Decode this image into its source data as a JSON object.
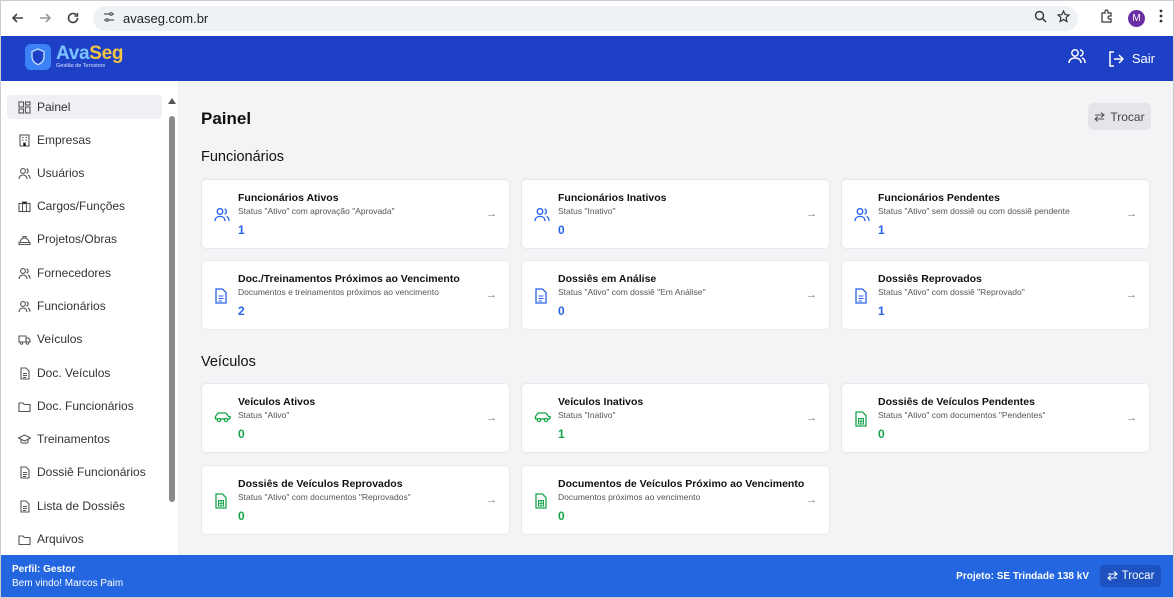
{
  "browser": {
    "url": "avaseg.com.br",
    "profile_initial": "M"
  },
  "app": {
    "brand_part1": "Ava",
    "brand_part2": "Seg",
    "brand_sub": "Gestão de Terceiros",
    "logout_label": "Sair"
  },
  "sidebar": {
    "items": [
      {
        "label": "Painel",
        "icon": "dashboard-icon",
        "active": true
      },
      {
        "label": "Empresas",
        "icon": "building-icon"
      },
      {
        "label": "Usuários",
        "icon": "users-icon"
      },
      {
        "label": "Cargos/Funções",
        "icon": "briefcase-icon"
      },
      {
        "label": "Projetos/Obras",
        "icon": "hard-hat-icon"
      },
      {
        "label": "Fornecedores",
        "icon": "users-icon"
      },
      {
        "label": "Funcionários",
        "icon": "users-icon"
      },
      {
        "label": "Veículos",
        "icon": "truck-icon"
      },
      {
        "label": "Doc. Veículos",
        "icon": "file-icon"
      },
      {
        "label": "Doc. Funcionários",
        "icon": "folder-icon"
      },
      {
        "label": "Treinamentos",
        "icon": "graduation-cap-icon"
      },
      {
        "label": "Dossiê Funcionários",
        "icon": "file-icon"
      },
      {
        "label": "Lista de Dossiês",
        "icon": "file-icon"
      },
      {
        "label": "Arquivos",
        "icon": "folder-icon"
      }
    ]
  },
  "main": {
    "title": "Painel",
    "switch_label": "Trocar",
    "sections": [
      {
        "title": "Funcionários",
        "cards": [
          {
            "title": "Funcionários Ativos",
            "subtitle": "Status \"Ativo\" com aprovação \"Aprovada\"",
            "value": "1",
            "icon": "users-icon",
            "color": "#2563eb"
          },
          {
            "title": "Funcionários Inativos",
            "subtitle": "Status \"Inativo\"",
            "value": "0",
            "icon": "users-icon",
            "color": "#2563eb"
          },
          {
            "title": "Funcionários Pendentes",
            "subtitle": "Status \"Ativo\" sem dossiê ou com dossiê pendente",
            "value": "1",
            "icon": "users-icon",
            "color": "#2563eb"
          },
          {
            "title": "Doc./Treinamentos Próximos ao Vencimento",
            "subtitle": "Documentos e treinamentos próximos ao vencimento",
            "value": "2",
            "icon": "file-text-icon",
            "color": "#2563eb"
          },
          {
            "title": "Dossiês em Análise",
            "subtitle": "Status \"Ativo\" com dossiê \"Em Análise\"",
            "value": "0",
            "icon": "file-text-icon",
            "color": "#2563eb"
          },
          {
            "title": "Dossiês Reprovados",
            "subtitle": "Status \"Ativo\" com dossiê \"Reprovado\"",
            "value": "1",
            "icon": "file-text-icon",
            "color": "#2563eb"
          }
        ]
      },
      {
        "title": "Veículos",
        "cards": [
          {
            "title": "Veículos Ativos",
            "subtitle": "Status \"Ativo\"",
            "value": "0",
            "icon": "car-icon",
            "color": "#16a34a"
          },
          {
            "title": "Veículos Inativos",
            "subtitle": "Status \"Inativo\"",
            "value": "1",
            "icon": "car-icon",
            "color": "#16a34a"
          },
          {
            "title": "Dossiês de Veículos Pendentes",
            "subtitle": "Status \"Ativo\" com documentos \"Pendentes\"",
            "value": "0",
            "icon": "file-spreadsheet-icon",
            "color": "#16a34a"
          },
          {
            "title": "Dossiês de Veículos Reprovados",
            "subtitle": "Status \"Ativo\" com documentos \"Reprovados\"",
            "value": "0",
            "icon": "file-spreadsheet-icon",
            "color": "#16a34a"
          },
          {
            "title": "Documentos de Veículos Próximo ao Vencimento",
            "subtitle": "Documentos próximos ao vencimento",
            "value": "0",
            "icon": "file-spreadsheet-icon",
            "color": "#16a34a"
          }
        ]
      }
    ]
  },
  "footer": {
    "profile": "Perfil: Gestor",
    "welcome": "Bem vindo! Marcos Paim",
    "project": "Projeto: SE Trindade 138 kV",
    "switch_label": "Trocar"
  }
}
